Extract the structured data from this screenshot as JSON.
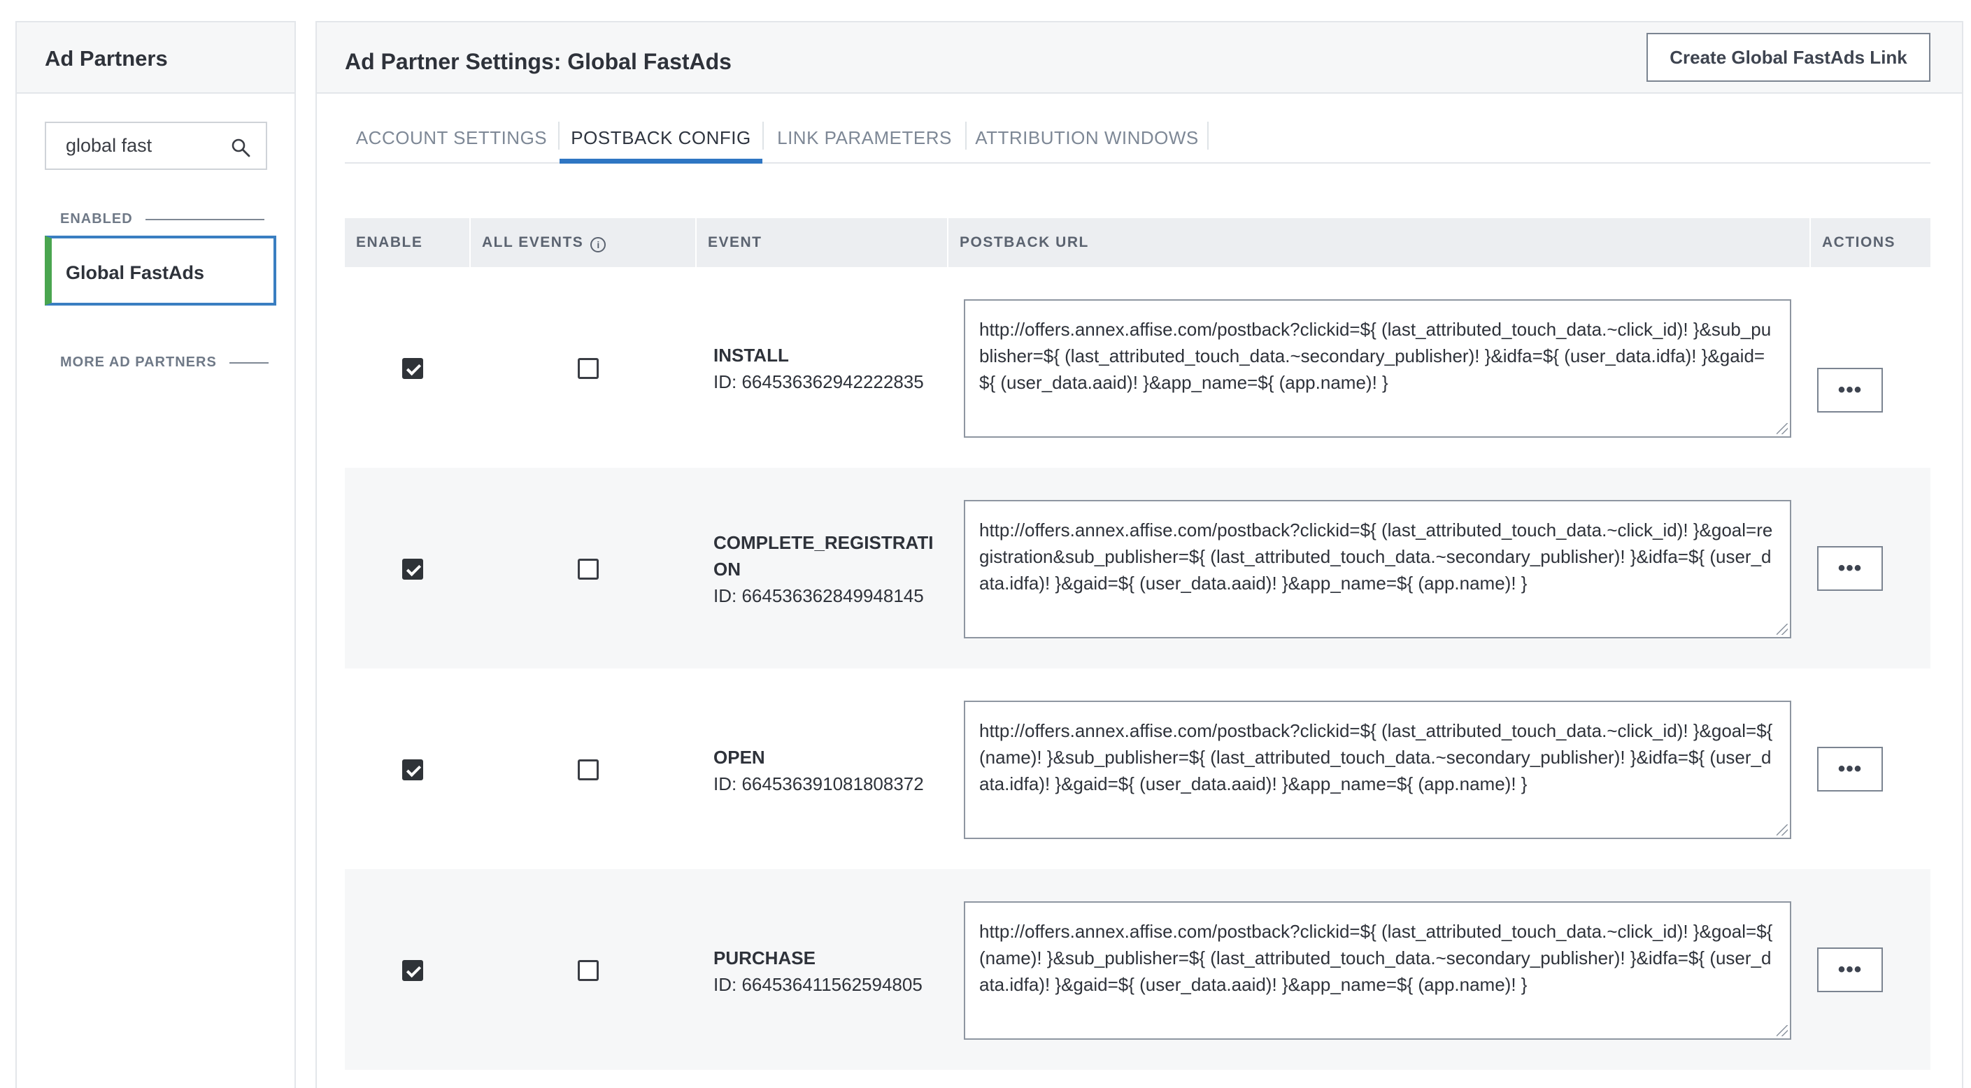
{
  "sidebar": {
    "title": "Ad Partners",
    "search": {
      "value": "global fast",
      "placeholder": ""
    },
    "enabled_label": "ENABLED",
    "selected_item": "Global FastAds",
    "more_label": "MORE AD PARTNERS"
  },
  "main": {
    "title": "Ad Partner Settings: Global FastAds",
    "create_button": "Create Global FastAds Link",
    "tabs": [
      {
        "label": "ACCOUNT SETTINGS",
        "active": false
      },
      {
        "label": "POSTBACK CONFIG",
        "active": true
      },
      {
        "label": "LINK PARAMETERS",
        "active": false
      },
      {
        "label": "ATTRIBUTION WINDOWS",
        "active": false
      }
    ]
  },
  "table": {
    "headers": {
      "enable": "ENABLE",
      "all_events": "ALL EVENTS",
      "event": "EVENT",
      "postback_url": "POSTBACK URL",
      "actions": "ACTIONS"
    },
    "info_icon": "info-icon",
    "rows": [
      {
        "enabled": true,
        "all_events": false,
        "event_name": "INSTALL",
        "event_id": "ID: 664536362942222835",
        "postback_url": "http://offers.annex.affise.com/postback?clickid=${ (last_attributed_touch_data.~click_id)! }&sub_publisher=${ (last_attributed_touch_data.~secondary_publisher)! }&idfa=${ (user_data.idfa)! }&gaid=${ (user_data.aaid)! }&app_name=${ (app.name)! }",
        "action": "•••"
      },
      {
        "enabled": true,
        "all_events": false,
        "event_name": "COMPLETE_REGISTRATION",
        "event_id": "ID: 664536362849948145",
        "postback_url": "http://offers.annex.affise.com/postback?clickid=${ (last_attributed_touch_data.~click_id)! }&goal=registration&sub_publisher=${ (last_attributed_touch_data.~secondary_publisher)! }&idfa=${ (user_data.idfa)! }&gaid=${ (user_data.aaid)! }&app_name=${ (app.name)! }",
        "action": "•••"
      },
      {
        "enabled": true,
        "all_events": false,
        "event_name": "OPEN",
        "event_id": "ID: 664536391081808372",
        "postback_url": "http://offers.annex.affise.com/postback?clickid=${ (last_attributed_touch_data.~click_id)! }&goal=${ (name)! }&sub_publisher=${ (last_attributed_touch_data.~secondary_publisher)! }&idfa=${ (user_data.idfa)! }&gaid=${ (user_data.aaid)! }&app_name=${ (app.name)! }",
        "action": "•••"
      },
      {
        "enabled": true,
        "all_events": false,
        "event_name": "PURCHASE",
        "event_id": "ID: 664536411562594805",
        "postback_url": "http://offers.annex.affise.com/postback?clickid=${ (last_attributed_touch_data.~click_id)! }&goal=${ (name)! }&sub_publisher=${ (last_attributed_touch_data.~secondary_publisher)! }&idfa=${ (user_data.idfa)! }&gaid=${ (user_data.aaid)! }&app_name=${ (app.name)! }",
        "action": "•••"
      }
    ]
  },
  "colors": {
    "accent": "#2f76c3",
    "enabled_marker": "#4aa54f",
    "selected_border": "#3a7ec1"
  }
}
